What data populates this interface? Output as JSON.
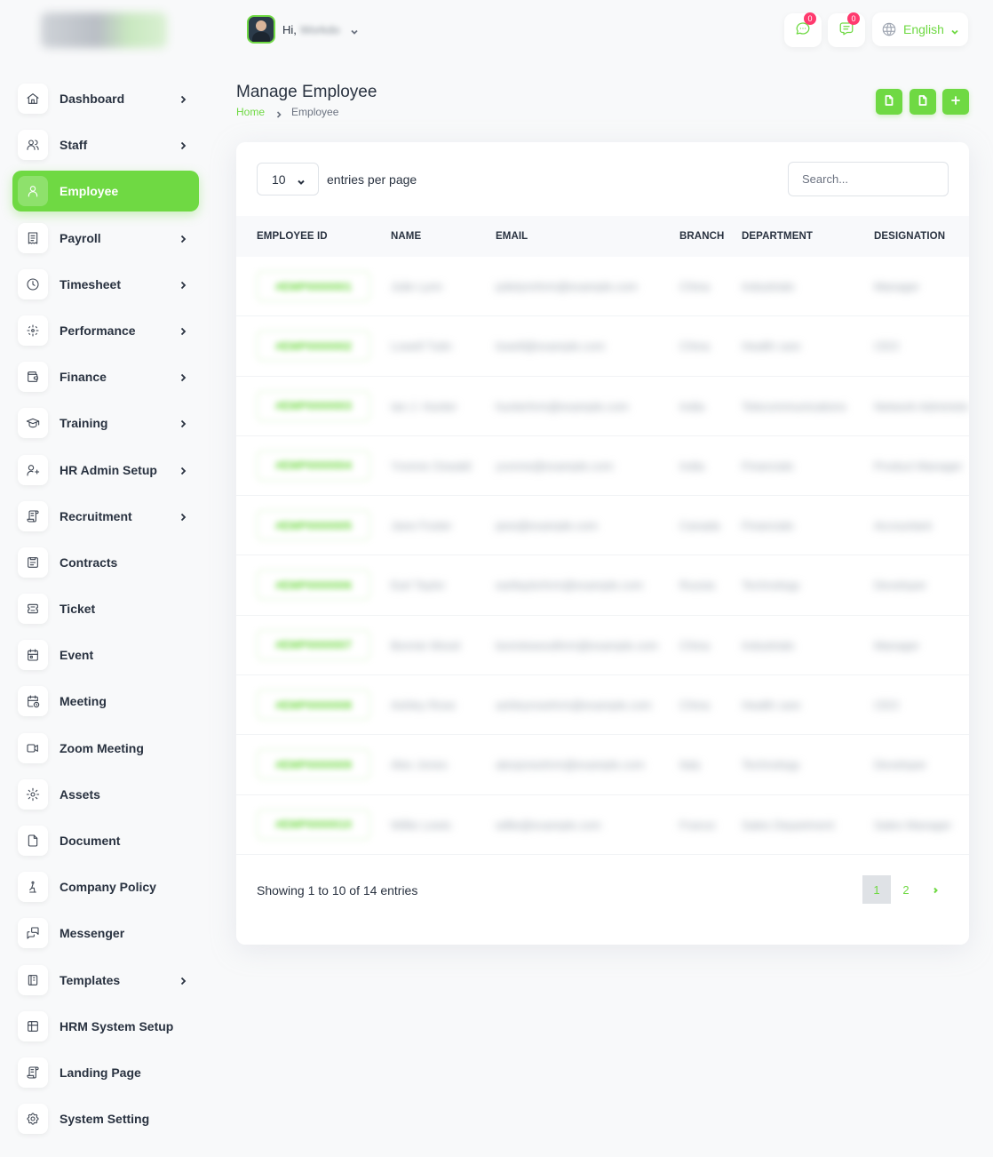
{
  "header": {
    "greeting": "Hi,",
    "user_name": "Workdo",
    "message_badge": "0",
    "chat_badge": "0",
    "language": "English"
  },
  "sidebar": {
    "items": [
      {
        "label": "Dashboard",
        "icon": "home-icon",
        "has_submenu": true
      },
      {
        "label": "Staff",
        "icon": "users-icon",
        "has_submenu": true
      },
      {
        "label": "Employee",
        "icon": "user-icon",
        "has_submenu": false,
        "active": true
      },
      {
        "label": "Payroll",
        "icon": "receipt-icon",
        "has_submenu": true
      },
      {
        "label": "Timesheet",
        "icon": "clock-icon",
        "has_submenu": true
      },
      {
        "label": "Performance",
        "icon": "target-icon",
        "has_submenu": true
      },
      {
        "label": "Finance",
        "icon": "wallet-icon",
        "has_submenu": true
      },
      {
        "label": "Training",
        "icon": "graduation-cap-icon",
        "has_submenu": true
      },
      {
        "label": "HR Admin Setup",
        "icon": "user-plus-icon",
        "has_submenu": true
      },
      {
        "label": "Recruitment",
        "icon": "license-icon",
        "has_submenu": true
      },
      {
        "label": "Contracts",
        "icon": "contract-icon",
        "has_submenu": false
      },
      {
        "label": "Ticket",
        "icon": "ticket-icon",
        "has_submenu": false
      },
      {
        "label": "Event",
        "icon": "calendar-event-icon",
        "has_submenu": false
      },
      {
        "label": "Meeting",
        "icon": "calendar-time-icon",
        "has_submenu": false
      },
      {
        "label": "Zoom Meeting",
        "icon": "video-icon",
        "has_submenu": false
      },
      {
        "label": "Assets",
        "icon": "cog-icon",
        "has_submenu": false
      },
      {
        "label": "Document",
        "icon": "file-icon",
        "has_submenu": false
      },
      {
        "label": "Company Policy",
        "icon": "pray-icon",
        "has_submenu": false
      },
      {
        "label": "Messenger",
        "icon": "messages-icon",
        "has_submenu": false
      },
      {
        "label": "Templates",
        "icon": "notebook-icon",
        "has_submenu": true
      },
      {
        "label": "HRM System Setup",
        "icon": "table-icon",
        "has_submenu": false
      },
      {
        "label": "Landing Page",
        "icon": "license-icon",
        "has_submenu": false
      },
      {
        "label": "System Setting",
        "icon": "settings-icon",
        "has_submenu": false
      }
    ]
  },
  "page": {
    "title": "Manage Employee",
    "breadcrumb_home": "Home",
    "breadcrumb_current": "Employee"
  },
  "table": {
    "per_page": "10",
    "per_page_label": "entries per page",
    "search_placeholder": "Search...",
    "columns": [
      "EMPLOYEE ID",
      "NAME",
      "EMAIL",
      "BRANCH",
      "DEPARTMENT",
      "DESIGNATION"
    ],
    "rows": [
      [
        "#EMP0000001",
        "Julie Lynn",
        "julielynnhrm@example.com",
        "China",
        "Industrials",
        "Manager"
      ],
      [
        "#EMP0000002",
        "Lowell Tutin",
        "lowell@example.com",
        "China",
        "Health care",
        "CEO"
      ],
      [
        "#EMP0000003",
        "Ian J. Hunter",
        "hunterhrm@example.com",
        "India",
        "Telecommunications",
        "Network Administrator"
      ],
      [
        "#EMP0000004",
        "Yvonne Oswald",
        "yvonne@example.com",
        "India",
        "Financials",
        "Product Manager"
      ],
      [
        "#EMP0000005",
        "Jane Foster",
        "jane@example.com",
        "Canada",
        "Financials",
        "Accountant"
      ],
      [
        "#EMP0000006",
        "Earl Taylor",
        "earltaylorhrm@example.com",
        "Russia",
        "Technology",
        "Developer"
      ],
      [
        "#EMP0000007",
        "Bonnie Wood",
        "bonniewoodhrm@example.com",
        "China",
        "Industrials",
        "Manager"
      ],
      [
        "#EMP0000008",
        "Ashley Rose",
        "ashleyrosehrm@example.com",
        "China",
        "Health care",
        "CEO"
      ],
      [
        "#EMP0000009",
        "Alex Jones",
        "alexjoneshrm@example.com",
        "Italy",
        "Technology",
        "Developer"
      ],
      [
        "#EMP0000010",
        "Willie Lewis",
        "willie@example.com",
        "France",
        "Sales Department",
        "Sales Manager"
      ]
    ],
    "showing": "Showing 1 to 10 of 14 entries",
    "pages": [
      "1",
      "2"
    ],
    "current_page": "1"
  },
  "colors": {
    "accent": "#6fd943",
    "badge": "#ff3a6e",
    "text": "#293240"
  }
}
